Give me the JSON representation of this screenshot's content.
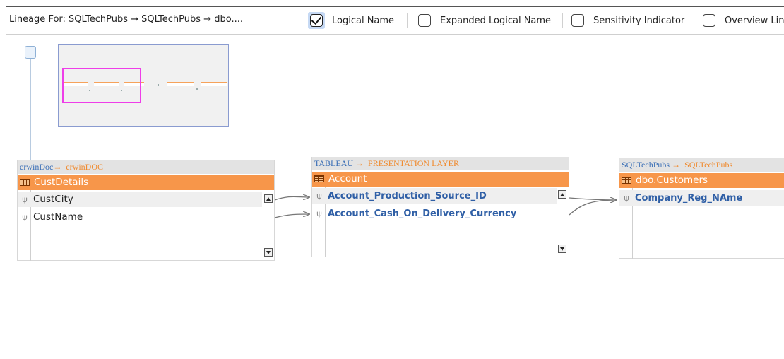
{
  "toolbar": {
    "lineage_title": "Lineage For: SQLTechPubs → SQLTechPubs → dbo....",
    "options": [
      {
        "label": "Logical Name",
        "checked": true
      },
      {
        "label": "Expanded Logical Name",
        "checked": false
      },
      {
        "label": "Sensitivity Indicator",
        "checked": false
      },
      {
        "label": "Overview Lin",
        "checked": false
      }
    ]
  },
  "tables": [
    {
      "source": "erwinDoc",
      "target": "erwinDOC",
      "name": "CustDetails",
      "columns": [
        "CustCity",
        "CustName"
      ]
    },
    {
      "source": "TABLEAU",
      "target": "PRESENTATION LAYER",
      "name": "Account",
      "columns": [
        "Account_Production_Source_ID",
        "Account_Cash_On_Delivery_Currency"
      ]
    },
    {
      "source": "SQLTechPubs",
      "target": "SQLTechPubs",
      "name": "dbo.Customers",
      "columns": [
        "Company_Reg_NAme"
      ]
    }
  ],
  "arrow_glyph": "→",
  "colors": {
    "header_bg": "#f7964a",
    "source_text": "#3b6fb6",
    "target_text": "#f08a2e",
    "column_bold": "#2f5fa6",
    "minimap_viewport": "#ee3ee8"
  }
}
